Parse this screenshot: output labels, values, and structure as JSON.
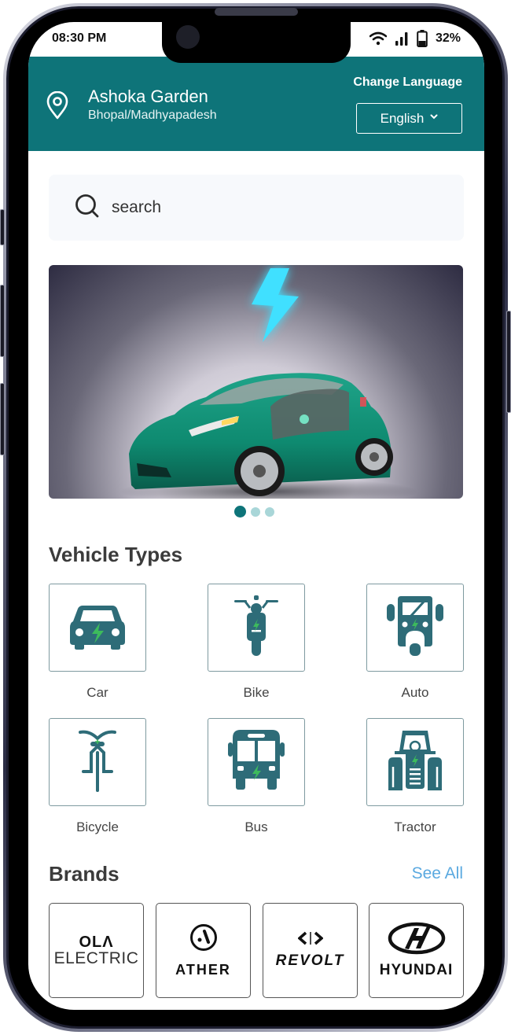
{
  "status_bar": {
    "time": "08:30 PM",
    "battery": "32%",
    "icons": [
      "wifi-icon",
      "signal-icon",
      "battery-icon"
    ]
  },
  "header": {
    "location_title": "Ashoka Garden",
    "location_subtitle": "Bhopal/Madhyapadesh",
    "change_language_label": "Change Language",
    "language_selected": "English",
    "brand_color": "#0e7479"
  },
  "search": {
    "placeholder": "search"
  },
  "carousel": {
    "slide_count": 3,
    "active_index": 0,
    "slide_description": "Green electric car with glowing blue lightning bolt"
  },
  "vehicle_types": {
    "title": "Vehicle Types",
    "items": [
      {
        "label": "Car",
        "icon": "car-icon"
      },
      {
        "label": "Bike",
        "icon": "scooter-icon"
      },
      {
        "label": "Auto",
        "icon": "auto-rickshaw-icon"
      },
      {
        "label": "Bicycle",
        "icon": "bicycle-icon"
      },
      {
        "label": "Bus",
        "icon": "bus-icon"
      },
      {
        "label": "Tractor",
        "icon": "tractor-icon"
      }
    ],
    "icon_color": "#2e6c78",
    "bolt_color": "#3dbb5c"
  },
  "brands": {
    "title": "Brands",
    "see_all_label": "See All",
    "items": [
      {
        "name": "Ola Electric",
        "logo_line1": "OLΛ",
        "logo_line2": "ELECTRIC"
      },
      {
        "name": "Ather",
        "logo_text": "ATHER"
      },
      {
        "name": "Revolt",
        "logo_text": "REVOLT"
      },
      {
        "name": "Hyundai",
        "logo_text": "HYUNDAI"
      }
    ]
  }
}
